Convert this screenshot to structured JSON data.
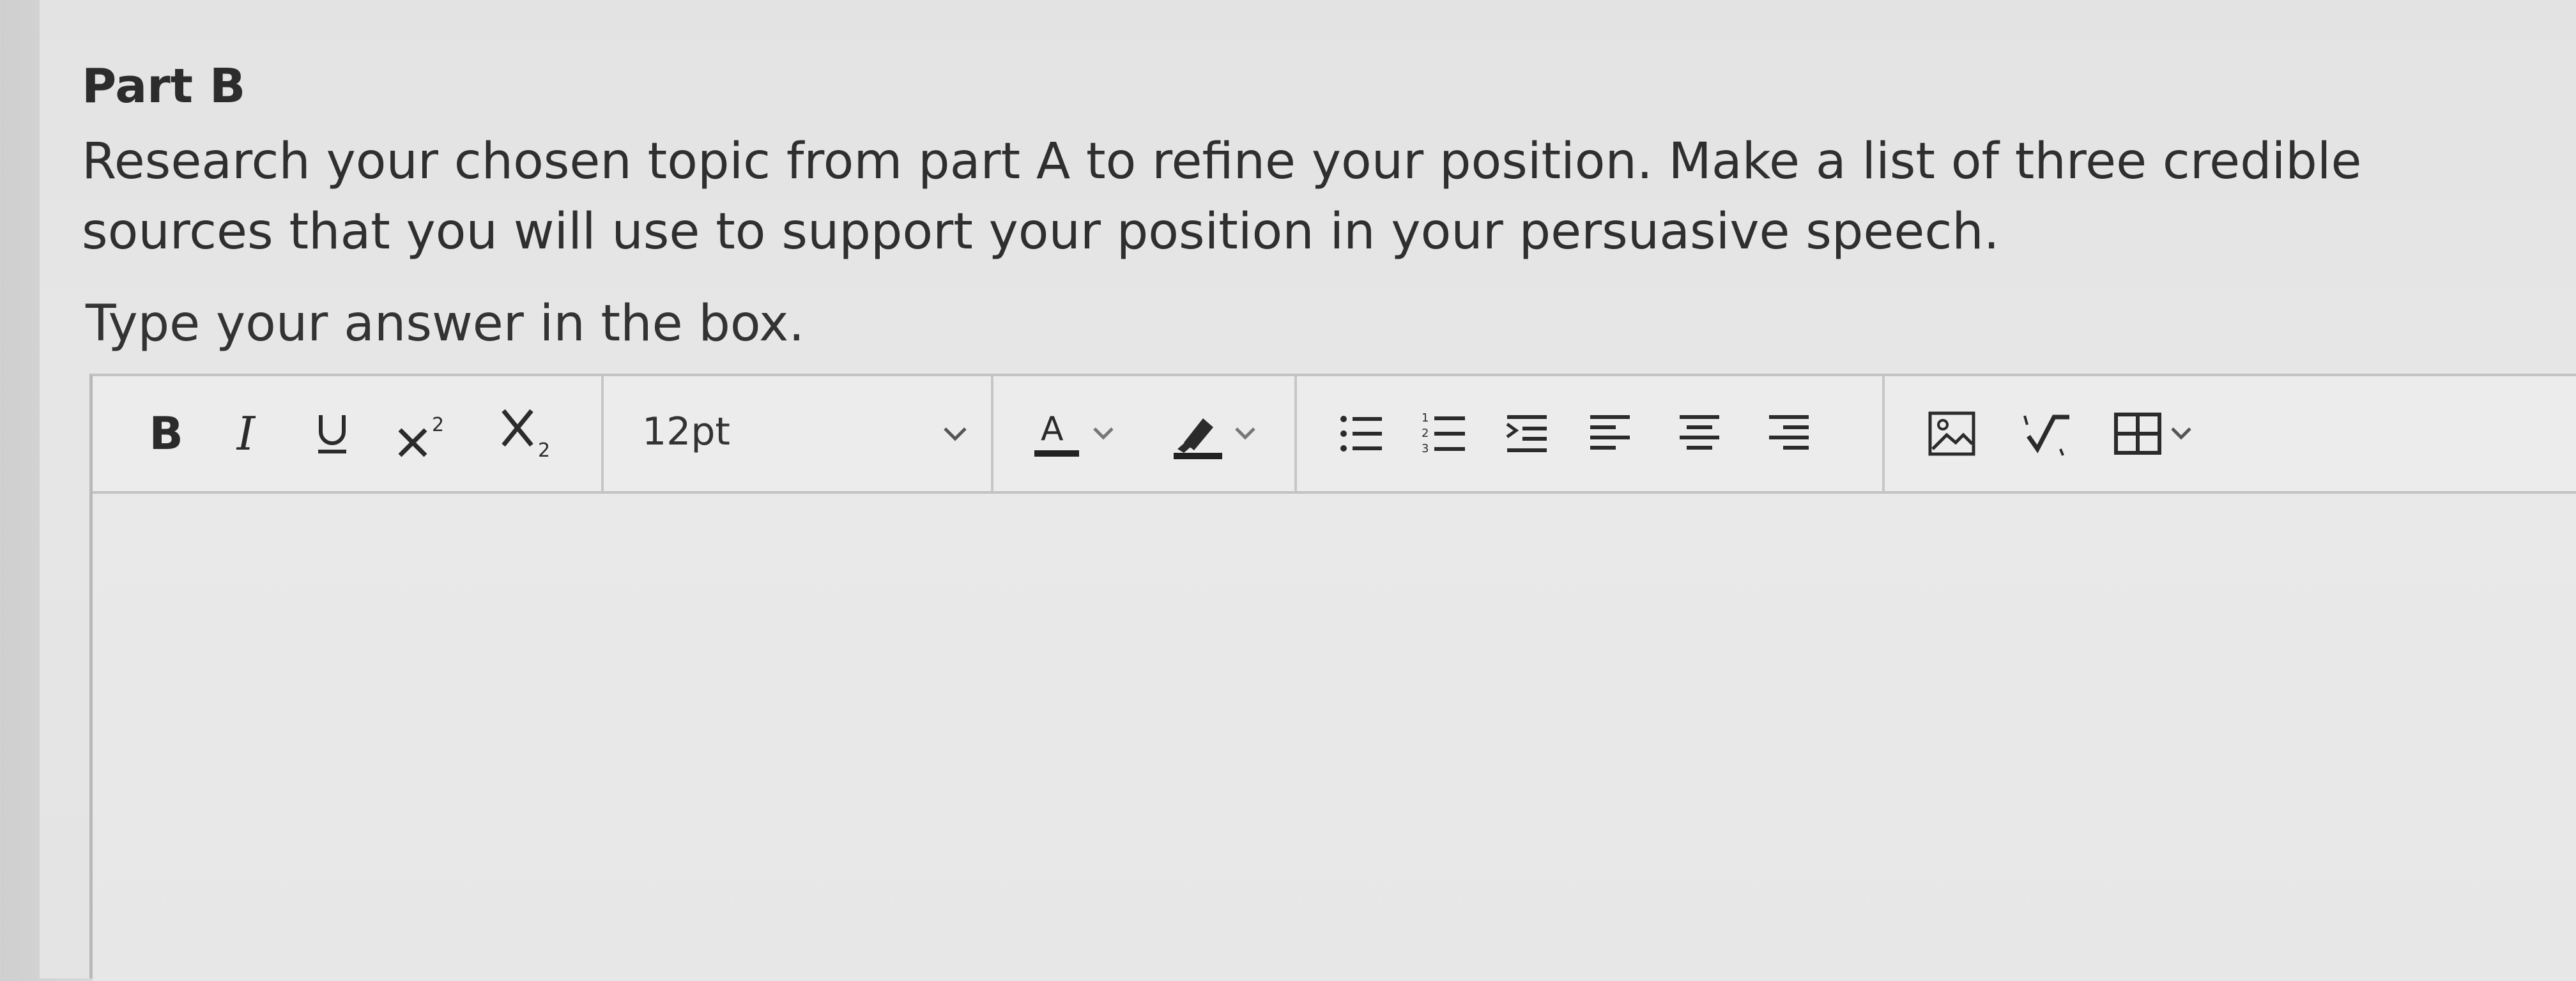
{
  "question": {
    "part_title": "Part B",
    "instructions": "Research your chosen topic from part A to refine your position. Make a list of three credible sources that you will use to support your position in your persuasive speech.",
    "prompt": "Type your answer in the box."
  },
  "editor": {
    "font_size": "12pt",
    "content": "",
    "toolbar": {
      "format_buttons": [
        "bold-icon",
        "italic-icon",
        "underline-icon",
        "superscript-icon",
        "subscript-icon"
      ],
      "color_buttons": [
        "text-color-icon",
        "highlight-color-icon"
      ],
      "paragraph_buttons": [
        "bulleted-list-icon",
        "numbered-list-icon",
        "indent-icon",
        "align-left-icon",
        "align-center-icon",
        "align-right-icon"
      ],
      "insert_buttons": [
        "insert-image-icon",
        "insert-equation-icon",
        "insert-table-icon"
      ]
    }
  },
  "colors": {
    "text_color_underline": "#222222",
    "highlight_underline": "#222222"
  }
}
